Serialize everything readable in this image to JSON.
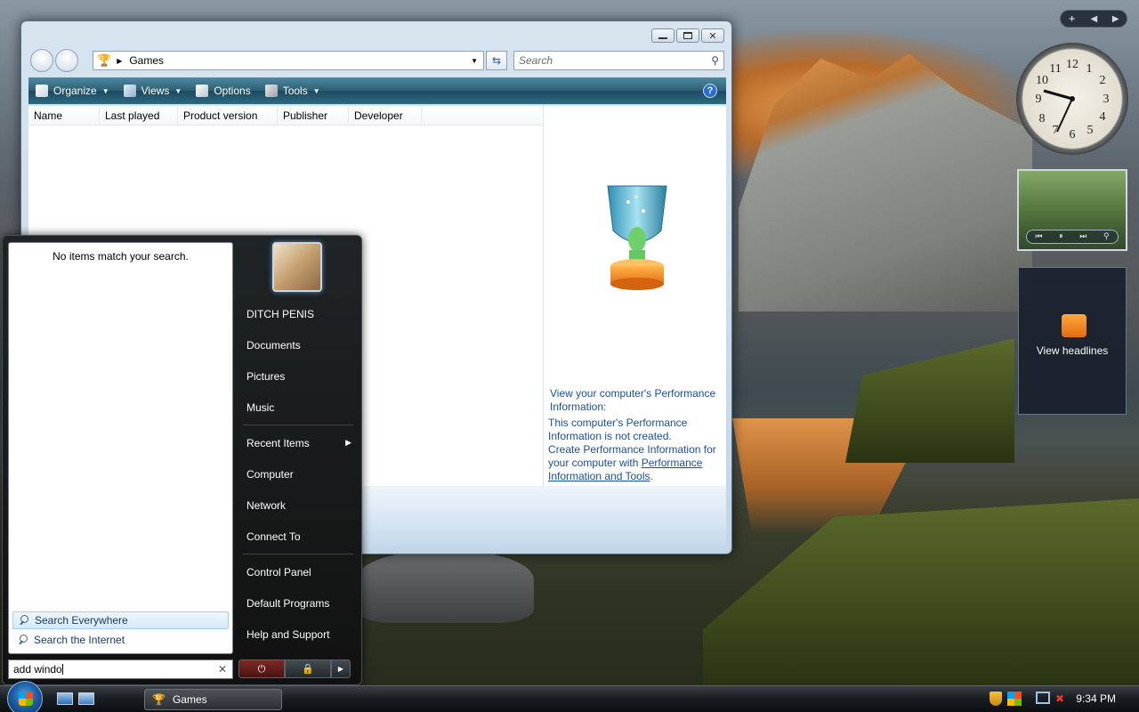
{
  "explorer": {
    "address": "Games",
    "search_placeholder": "Search",
    "toolbar": {
      "organize": "Organize",
      "views": "Views",
      "options": "Options",
      "tools": "Tools"
    },
    "columns": [
      "Name",
      "Last played",
      "Product version",
      "Publisher",
      "Developer"
    ],
    "preview": {
      "heading": "View your computer's Performance Information:",
      "line1": "This computer's Performance Information is not created.",
      "line2_prefix": "Create Performance Information for your computer with ",
      "link": "Performance Information and Tools",
      "line2_suffix": "."
    }
  },
  "start_menu": {
    "no_results": "No items match your search.",
    "search_everywhere": "Search Everywhere",
    "search_internet": "Search the Internet",
    "search_query": "add windo",
    "right_items": [
      "DITCH PENIS",
      "Documents",
      "Pictures",
      "Music",
      "Recent Items",
      "Computer",
      "Network",
      "Connect To",
      "Control Panel",
      "Default Programs",
      "Help and Support"
    ]
  },
  "taskbar": {
    "task": "Games",
    "clock": "9:34 PM"
  },
  "sidebar": {
    "feed_text": "View headlines"
  }
}
